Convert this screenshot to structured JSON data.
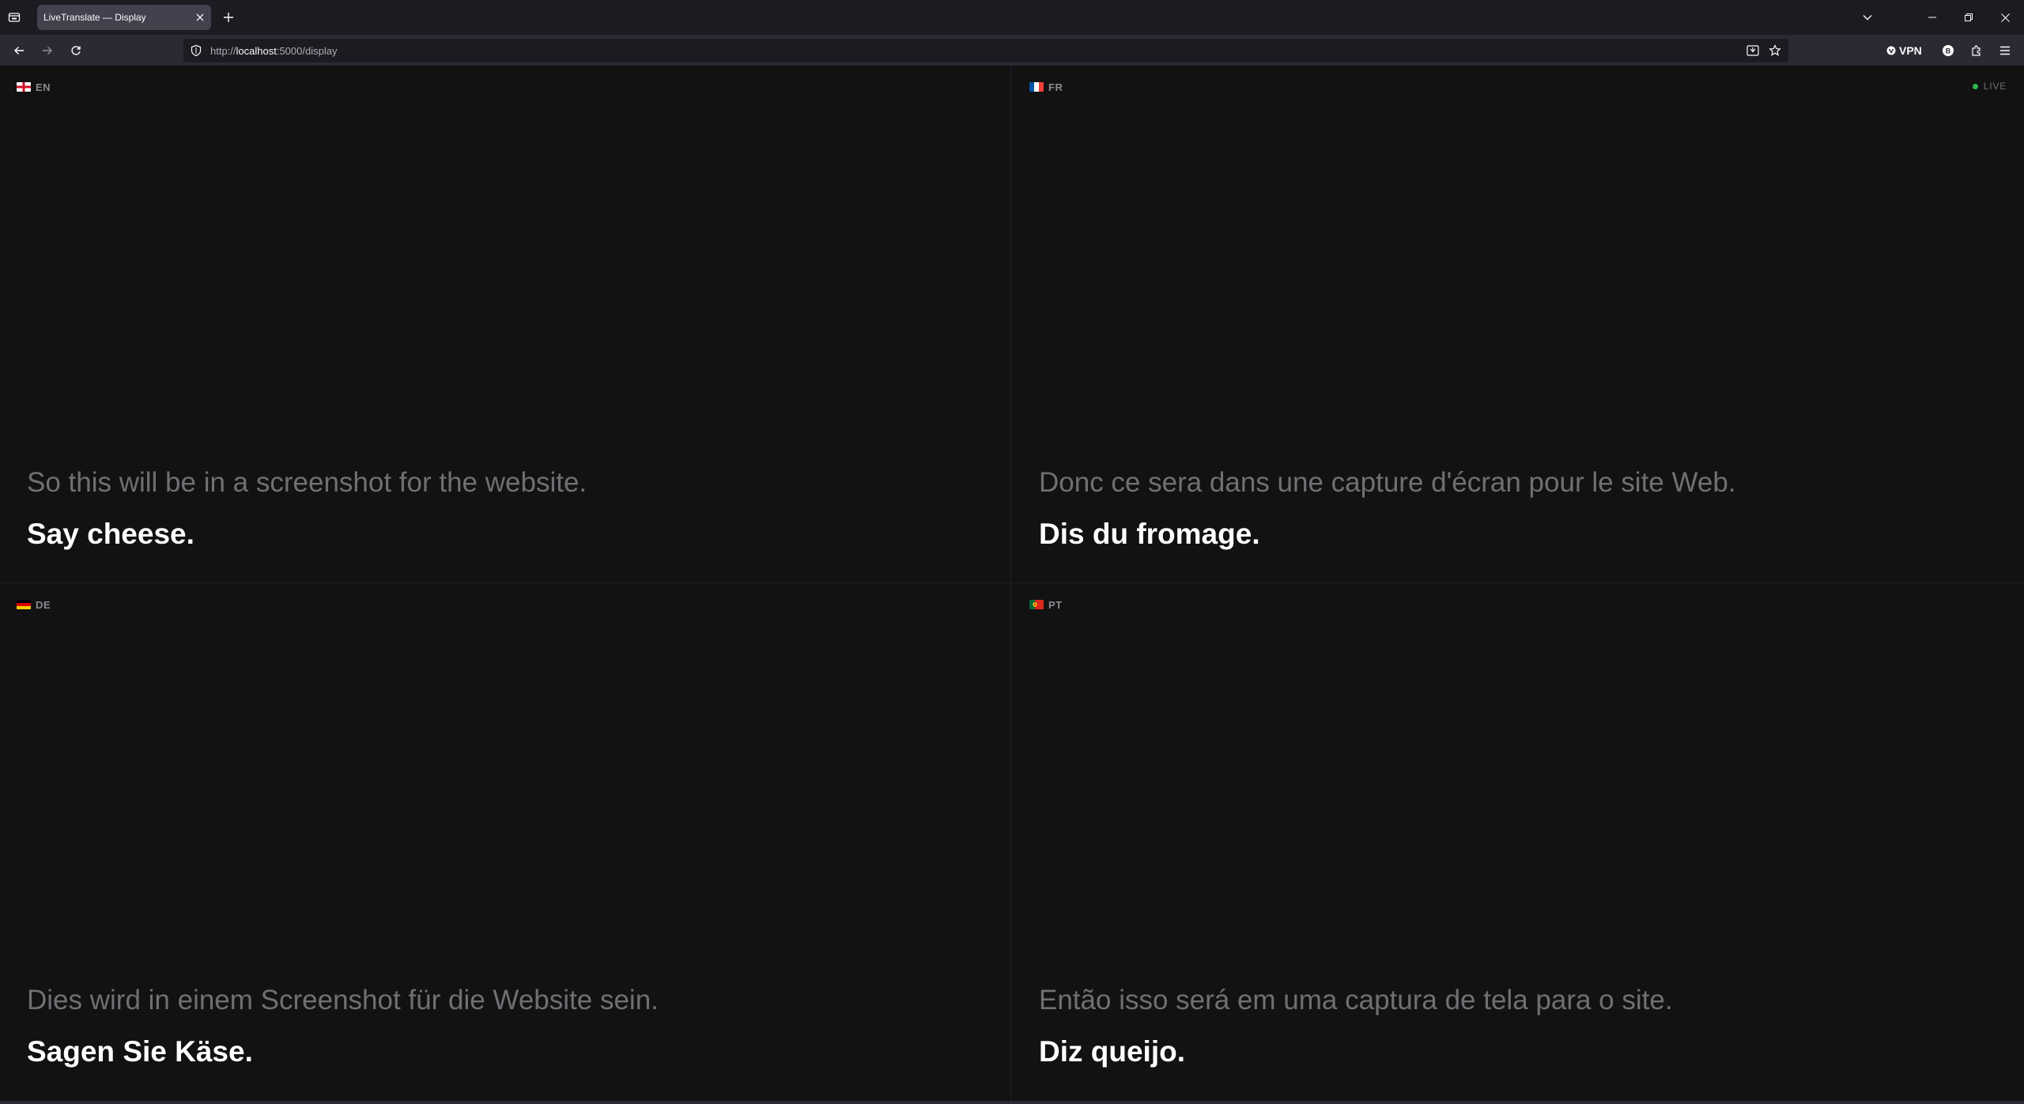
{
  "browser": {
    "tab_title": "LiveTranslate — Display",
    "url_scheme": "http://",
    "url_host": "localhost",
    "url_rest": ":5000/display",
    "vpn_label": "VPN"
  },
  "status": {
    "live_label": "LIVE",
    "live_color": "#2fb84f"
  },
  "panels": [
    {
      "code": "EN",
      "flag": "england-flag",
      "previous": "So this will be in a screenshot for the website.",
      "current": "Say cheese."
    },
    {
      "code": "FR",
      "flag": "france-flag",
      "previous": "Donc ce sera dans une capture d'écran pour le site Web.",
      "current": "Dis du fromage."
    },
    {
      "code": "DE",
      "flag": "germany-flag",
      "previous": "Dies wird in einem Screenshot für die Website sein.",
      "current": "Sagen Sie Käse."
    },
    {
      "code": "PT",
      "flag": "portugal-flag",
      "previous": "Então isso será em uma captura de tela para o site.",
      "current": "Diz queijo."
    }
  ]
}
